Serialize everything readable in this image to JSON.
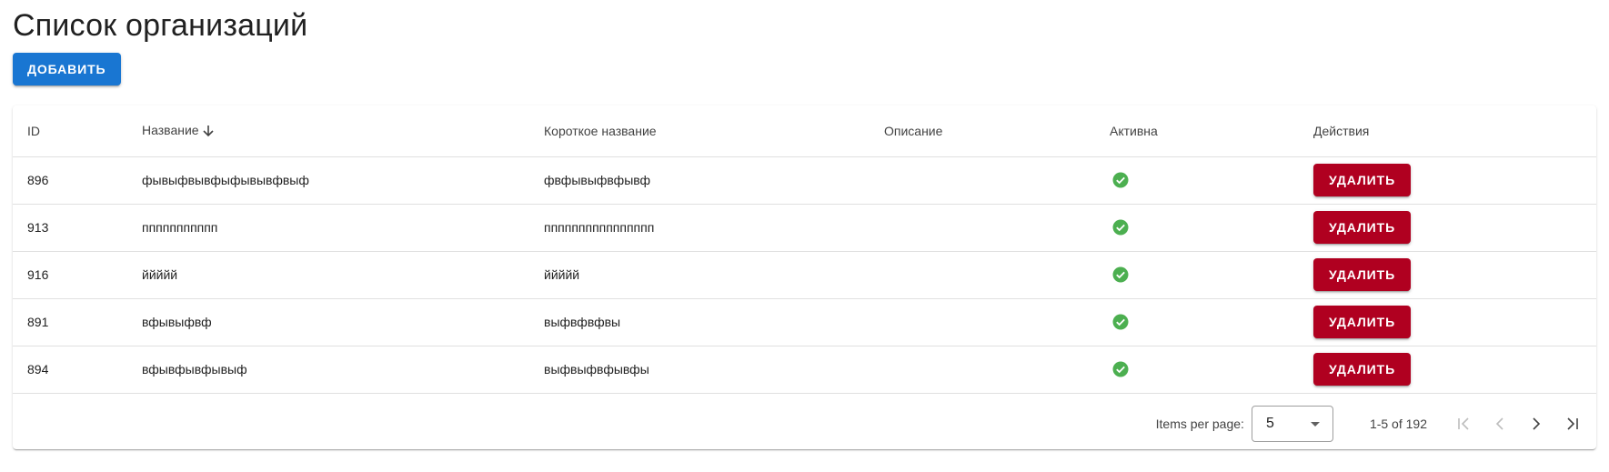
{
  "page": {
    "title": "Список организаций",
    "add_button_label": "Добавить"
  },
  "colors": {
    "primary": "#1976d2",
    "danger": "#b00020",
    "success": "#4caf50"
  },
  "table": {
    "headers": {
      "id": "ID",
      "name": "Название",
      "short_name": "Короткое название",
      "description": "Описание",
      "active": "Активна",
      "actions": "Действия"
    },
    "sort": {
      "column": "name",
      "direction": "desc",
      "icon": "arrow-down-icon"
    },
    "rows": [
      {
        "id": "896",
        "name": "фывыфвывфыфывывфвыф",
        "short_name": "фвфывыфвфывф",
        "description": "",
        "active": true,
        "delete_label": "Удалить"
      },
      {
        "id": "913",
        "name": "ппппппппппп",
        "short_name": "пппппппппппппппп",
        "description": "",
        "active": true,
        "delete_label": "Удалить"
      },
      {
        "id": "916",
        "name": "ййййй",
        "short_name": "ййййй",
        "description": "",
        "active": true,
        "delete_label": "Удалить"
      },
      {
        "id": "891",
        "name": "вфывыфвф",
        "short_name": "выфвфвфвы",
        "description": "",
        "active": true,
        "delete_label": "Удалить"
      },
      {
        "id": "894",
        "name": "вфывфывфывыф",
        "short_name": "выфвыфвфывфы",
        "description": "",
        "active": true,
        "delete_label": "Удалить"
      }
    ]
  },
  "paginator": {
    "items_per_page_label": "Items per page:",
    "page_size": "5",
    "range_label": "1-5 of 192"
  }
}
